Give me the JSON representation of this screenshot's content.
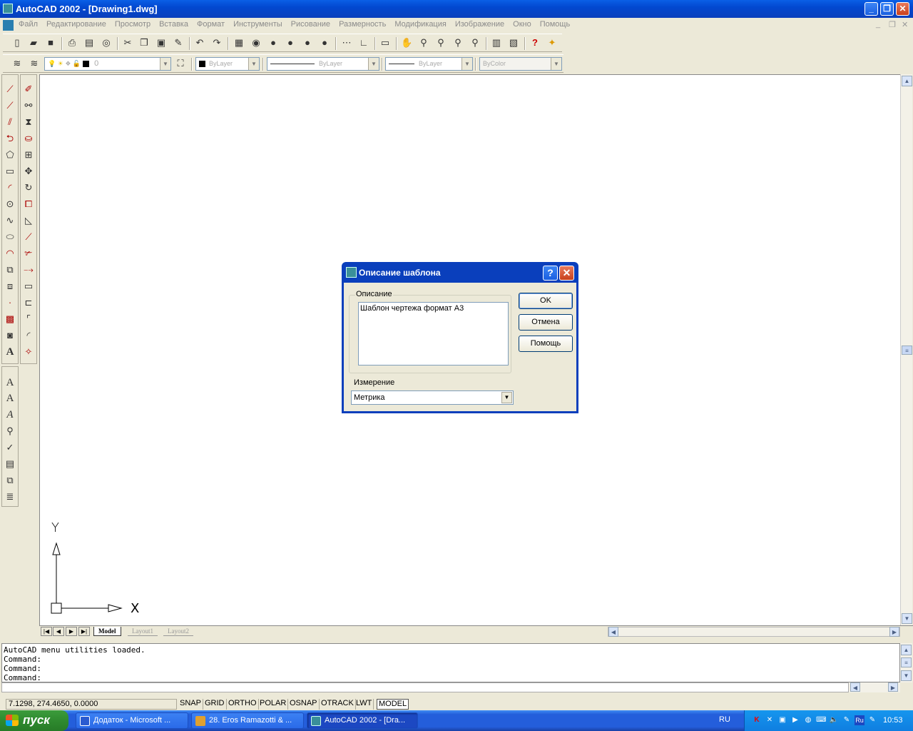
{
  "window": {
    "title": "AutoCAD 2002 - [Drawing1.dwg]",
    "minimize_glyph": "_",
    "restore_glyph": "❐",
    "close_glyph": "✕"
  },
  "menu": {
    "items": [
      "Файл",
      "Редактирование",
      "Просмотр",
      "Вставка",
      "Формат",
      "Инструменты",
      "Рисование",
      "Размерность",
      "Модификация",
      "Изображение",
      "Окно",
      "Помощь"
    ],
    "doc_minimize": "_",
    "doc_restore": "❐",
    "doc_close": "✕"
  },
  "properties_toolbar": {
    "layer_value": "0",
    "color_value": "ByLayer",
    "linetype_value": "ByLayer",
    "lineweight_value": "ByLayer",
    "plotstyle_value": "ByColor"
  },
  "tabs": {
    "model": "Model",
    "layout1": "Layout1",
    "layout2": "Layout2"
  },
  "axes": {
    "y_label": "Y",
    "x_label": "X"
  },
  "command_window": {
    "lines": [
      "AutoCAD menu utilities loaded.",
      "Command:",
      "Command:",
      "Command:"
    ]
  },
  "status": {
    "coords": "7.1298,  274.4650, 0.0000",
    "toggles": [
      "SNAP",
      "GRID",
      "ORTHO",
      "POLAR",
      "OSNAP",
      "OTRACK",
      "LWT",
      "MODEL"
    ]
  },
  "dialog": {
    "title": "Описание шаблона",
    "help_glyph": "?",
    "close_glyph": "✕",
    "description_label": "Описание",
    "description_value": "Шаблон чертежа формат А3",
    "measurement_label": "Измерение",
    "measurement_value": "Метрика",
    "ok_label": "OK",
    "cancel_label": "Отмена",
    "help_label": "Помощь"
  },
  "taskbar": {
    "start_label": "пуск",
    "tasks": [
      "Додаток - Microsoft ...",
      "28. Eros Ramazotti & ...",
      "AutoCAD 2002 - [Dra..."
    ],
    "language": "RU",
    "clock": "10:53"
  },
  "colors": {
    "title_blue": "#0a3fbc",
    "taskbar_blue": "#245edb",
    "start_green": "#2f8a2f",
    "tray_blue": "#0f7ee0"
  }
}
